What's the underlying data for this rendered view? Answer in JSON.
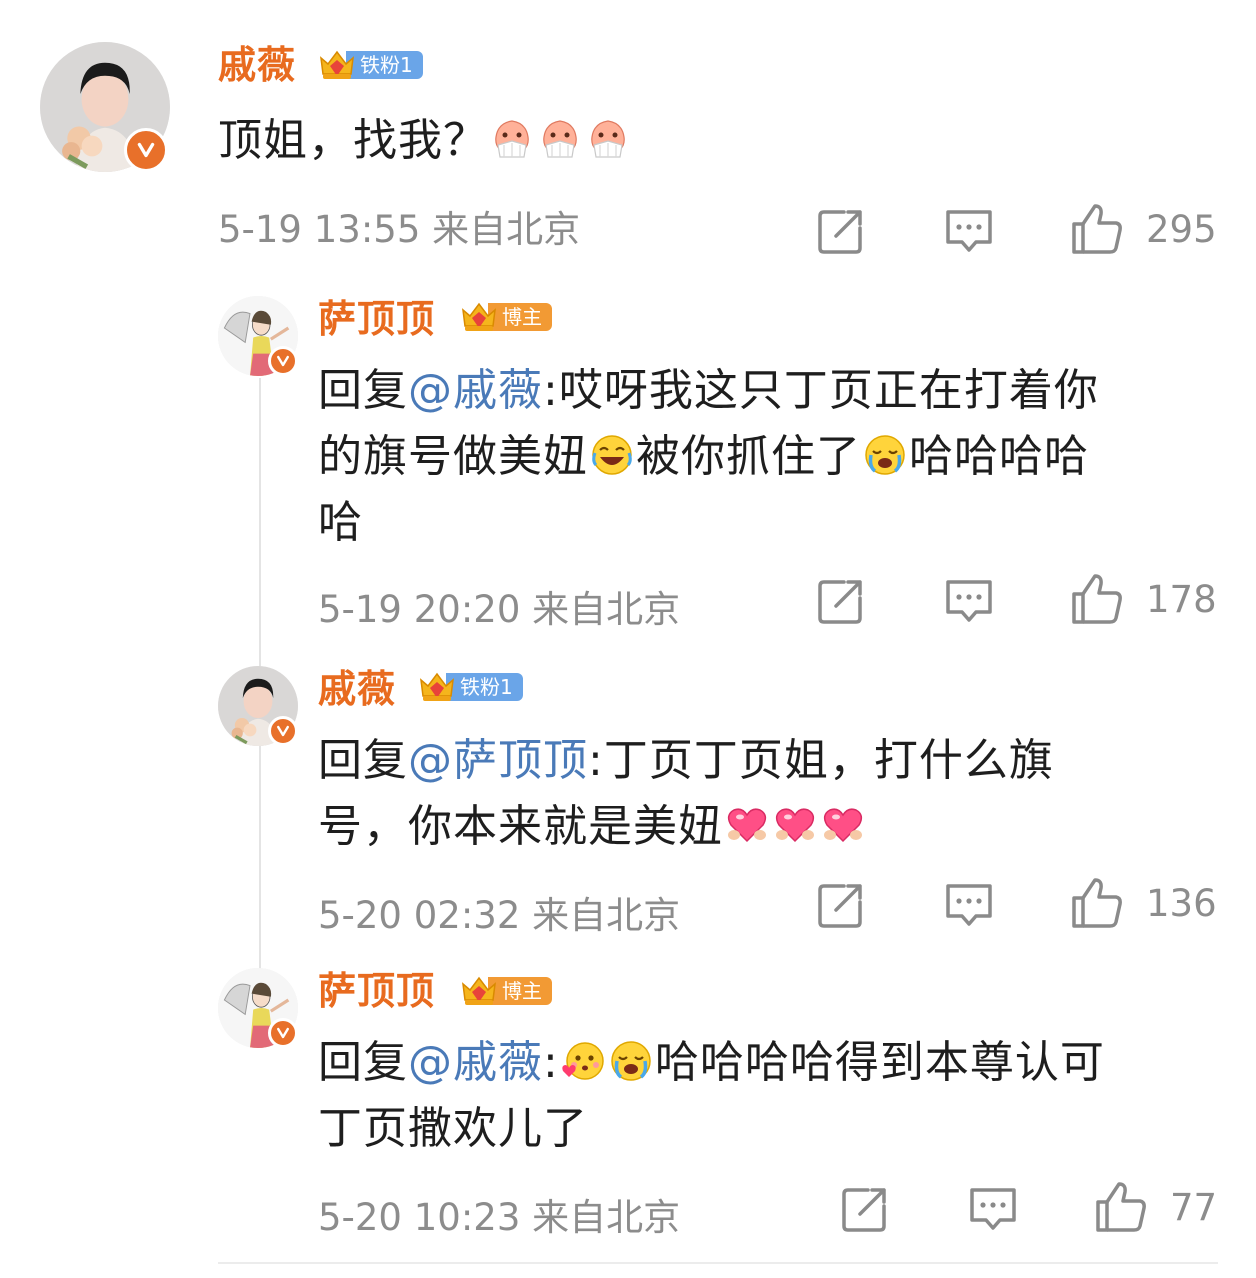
{
  "comments": [
    {
      "author": "戚薇",
      "badge": "铁粉1",
      "segments": [
        {
          "t": "顶姐，找我？"
        }
      ],
      "emoji_name": "shy-fan-emoji",
      "time": "5-19 13:55",
      "location": "来自北京",
      "likes": "295"
    },
    {
      "author": "萨顶顶",
      "badge": "博主",
      "reply_prefix": "回复",
      "mention": "@戚薇",
      "line1": ":哎呀我这只丁页正在打着你",
      "line2a": "的旗号做美妞",
      "line2b": "被你抓住了",
      "line2c": "哈哈哈哈",
      "line3": "哈",
      "time": "5-19 20:20",
      "location": "来自北京",
      "likes": "178"
    },
    {
      "author": "戚薇",
      "badge": "铁粉1",
      "reply_prefix": "回复",
      "mention": "@萨顶顶",
      "line1": ":丁页丁页姐，打什么旗",
      "line2": "号，你本来就是美妞",
      "time": "5-20 02:32",
      "location": "来自北京",
      "likes": "136"
    },
    {
      "author": "萨顶顶",
      "badge": "博主",
      "reply_prefix": "回复",
      "mention": "@戚薇",
      "line1a": ":",
      "line1b": "哈哈哈哈得到本尊认可",
      "line2": "丁页撒欢儿了",
      "time": "5-20 10:23",
      "location": "来自北京",
      "likes": "77"
    }
  ],
  "icons": {
    "share": "share-icon",
    "comment": "comment-icon",
    "like": "thumbs-up-icon"
  },
  "colors": {
    "name": "#e86b1f",
    "mention": "#4a7ab8",
    "meta": "#8c8c8c",
    "fan_badge": "#6aa5e8",
    "host_badge": "#f29a34"
  }
}
